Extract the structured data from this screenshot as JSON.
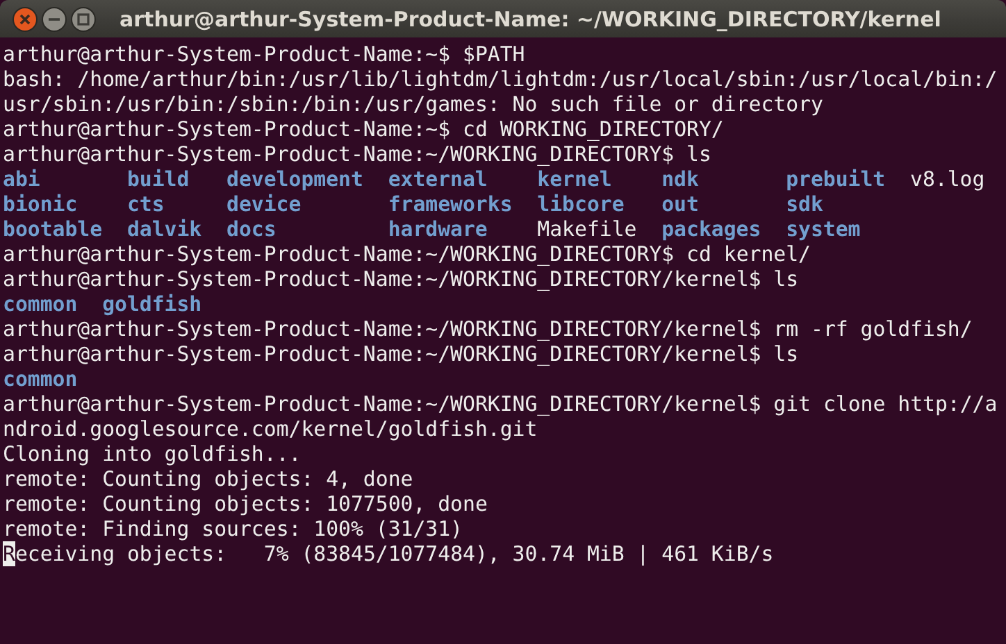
{
  "window": {
    "title": "arthur@arthur-System-Product-Name: ~/WORKING_DIRECTORY/kernel"
  },
  "terminal": {
    "lines": [
      {
        "kind": "text",
        "text": "arthur@arthur-System-Product-Name:~$ $PATH"
      },
      {
        "kind": "text",
        "text": "bash: /home/arthur/bin:/usr/lib/lightdm/lightdm:/usr/local/sbin:/usr/local/bin:/"
      },
      {
        "kind": "text",
        "text": "usr/sbin:/usr/bin:/sbin:/bin:/usr/games: No such file or directory"
      },
      {
        "kind": "text",
        "text": "arthur@arthur-System-Product-Name:~$ cd WORKING_DIRECTORY/"
      },
      {
        "kind": "text",
        "text": "arthur@arthur-System-Product-Name:~/WORKING_DIRECTORY$ ls"
      },
      {
        "kind": "ls",
        "rows": [
          [
            {
              "name": "abi",
              "kind": "dir"
            },
            {
              "name": "build",
              "kind": "dir"
            },
            {
              "name": "development",
              "kind": "dir"
            },
            {
              "name": "external",
              "kind": "dir"
            },
            {
              "name": "kernel",
              "kind": "dir"
            },
            {
              "name": "ndk",
              "kind": "dir"
            },
            {
              "name": "prebuilt",
              "kind": "dir"
            },
            {
              "name": "v8.log",
              "kind": "file"
            }
          ],
          [
            {
              "name": "bionic",
              "kind": "dir"
            },
            {
              "name": "cts",
              "kind": "dir"
            },
            {
              "name": "device",
              "kind": "dir"
            },
            {
              "name": "frameworks",
              "kind": "dir"
            },
            {
              "name": "libcore",
              "kind": "dir"
            },
            {
              "name": "out",
              "kind": "dir"
            },
            {
              "name": "sdk",
              "kind": "dir"
            }
          ],
          [
            {
              "name": "bootable",
              "kind": "dir"
            },
            {
              "name": "dalvik",
              "kind": "dir"
            },
            {
              "name": "docs",
              "kind": "dir"
            },
            {
              "name": "hardware",
              "kind": "dir"
            },
            {
              "name": "Makefile",
              "kind": "file"
            },
            {
              "name": "packages",
              "kind": "dir"
            },
            {
              "name": "system",
              "kind": "dir"
            }
          ]
        ]
      },
      {
        "kind": "text",
        "text": "arthur@arthur-System-Product-Name:~/WORKING_DIRECTORY$ cd kernel/"
      },
      {
        "kind": "text",
        "text": "arthur@arthur-System-Product-Name:~/WORKING_DIRECTORY/kernel$ ls"
      },
      {
        "kind": "ls",
        "rows": [
          [
            {
              "name": "common",
              "kind": "dir"
            },
            {
              "name": "goldfish",
              "kind": "dir"
            }
          ]
        ]
      },
      {
        "kind": "text",
        "text": "arthur@arthur-System-Product-Name:~/WORKING_DIRECTORY/kernel$ rm -rf goldfish/"
      },
      {
        "kind": "text",
        "text": "arthur@arthur-System-Product-Name:~/WORKING_DIRECTORY/kernel$ ls"
      },
      {
        "kind": "ls",
        "rows": [
          [
            {
              "name": "common",
              "kind": "dir"
            }
          ]
        ]
      },
      {
        "kind": "text",
        "text": "arthur@arthur-System-Product-Name:~/WORKING_DIRECTORY/kernel$ git clone http://a"
      },
      {
        "kind": "text",
        "text": "ndroid.googlesource.com/kernel/goldfish.git"
      },
      {
        "kind": "text",
        "text": "Cloning into goldfish..."
      },
      {
        "kind": "text",
        "text": "remote: Counting objects: 4, done"
      },
      {
        "kind": "text",
        "text": "remote: Counting objects: 1077500, done"
      },
      {
        "kind": "text",
        "text": "remote: Finding sources: 100% (31/31)"
      },
      {
        "kind": "cursor",
        "text": "Receiving objects:   7% (83845/1077484), 30.74 MiB | 461 KiB/s"
      }
    ]
  }
}
